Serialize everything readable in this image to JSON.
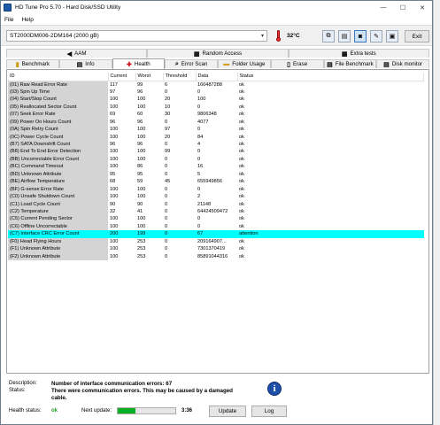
{
  "window": {
    "title": "HD Tune Pro 5.70 - Hard Disk/SSD Utility",
    "minimize": "—",
    "maximize": "☐",
    "close": "✕"
  },
  "menu": {
    "file": "File",
    "help": "Help"
  },
  "toolbar": {
    "drive": "ST2000DM006-2DM164 (2000 gB)",
    "temperature": "32°C",
    "exit": "Exit"
  },
  "tabs": {
    "top": [
      {
        "label": "AAM"
      },
      {
        "label": "Random Access"
      },
      {
        "label": "Extra tests"
      }
    ],
    "bottom": [
      {
        "label": "Benchmark"
      },
      {
        "label": "Info"
      },
      {
        "label": "Health"
      },
      {
        "label": "Error Scan"
      },
      {
        "label": "Folder Usage"
      },
      {
        "label": "Erase"
      },
      {
        "label": "File Benchmark"
      },
      {
        "label": "Disk monitor"
      }
    ],
    "active": "Health"
  },
  "table": {
    "columns": [
      "ID",
      "Current",
      "Worst",
      "Threshold",
      "Data",
      "Status"
    ],
    "rows": [
      [
        "(01) Raw Read Error Rate",
        "117",
        "99",
        "6",
        "160487288",
        "ok"
      ],
      [
        "(03) Spin Up Time",
        "97",
        "96",
        "0",
        "0",
        "ok"
      ],
      [
        "(04) Start/Stop Count",
        "100",
        "100",
        "20",
        "100",
        "ok"
      ],
      [
        "(05) Reallocated Sector Count",
        "100",
        "100",
        "10",
        "0",
        "ok"
      ],
      [
        "(07) Seek Error Rate",
        "69",
        "60",
        "30",
        "9806348",
        "ok"
      ],
      [
        "(09) Power On Hours Count",
        "96",
        "96",
        "0",
        "4077",
        "ok"
      ],
      [
        "(0A) Spin Retry Count",
        "100",
        "100",
        "97",
        "0",
        "ok"
      ],
      [
        "(0C) Power Cycle Count",
        "100",
        "100",
        "20",
        "84",
        "ok"
      ],
      [
        "(B7) SATA Downshift Count",
        "96",
        "96",
        "0",
        "4",
        "ok"
      ],
      [
        "(B8) End To End Error Detection",
        "100",
        "100",
        "99",
        "0",
        "ok"
      ],
      [
        "(BB) Uncorrectable Error Count",
        "100",
        "100",
        "0",
        "0",
        "ok"
      ],
      [
        "(BC) Command Timeout",
        "100",
        "86",
        "0",
        "16",
        "ok"
      ],
      [
        "(BD) Unknown Attribute",
        "95",
        "95",
        "0",
        "5",
        "ok"
      ],
      [
        "(BE) Airflow Temperature",
        "68",
        "59",
        "45",
        "655949856",
        "ok"
      ],
      [
        "(BF) G-sense Error Rate",
        "100",
        "100",
        "0",
        "0",
        "ok"
      ],
      [
        "(C0) Unsafe Shutdown Count",
        "100",
        "100",
        "0",
        "2",
        "ok"
      ],
      [
        "(C1) Load Cycle Count",
        "90",
        "90",
        "0",
        "21148",
        "ok"
      ],
      [
        "(C2) Temperature",
        "32",
        "41",
        "0",
        "64424509472",
        "ok"
      ],
      [
        "(C5) Current Pending Sector",
        "100",
        "100",
        "0",
        "0",
        "ok"
      ],
      [
        "(C6) Offline Uncorrectable",
        "100",
        "100",
        "0",
        "0",
        "ok"
      ],
      [
        "(C7) Interface CRC Error Count",
        "200",
        "199",
        "0",
        "67",
        "attention"
      ],
      [
        "(F0) Head Flying Hours",
        "100",
        "253",
        "0",
        "209164907...",
        "ok"
      ],
      [
        "(F1) Unknown Attribute",
        "100",
        "253",
        "0",
        "7301370419",
        "ok"
      ],
      [
        "(F2) Unknown Attribute",
        "100",
        "253",
        "0",
        "85891044316",
        "ok"
      ]
    ],
    "highlight_color": "#00ffff"
  },
  "bottom": {
    "description_label": "Description:",
    "description": "Number of interface communication errors: 67",
    "status_label": "Status:",
    "status_line1": "There were communication errors. This may be caused by a damaged",
    "status_line2": "cable.",
    "health_label": "Health status:",
    "health_value": "ok",
    "next_update_label": "Next update:",
    "next_update_time": "3:36",
    "progress_percent": 30,
    "update_button": "Update",
    "log_button": "Log"
  },
  "icons": [
    "app-icon",
    "thermometer-icon",
    "copy-icon",
    "copy-all-icon",
    "screenshot-icon",
    "options-icon",
    "save-icon",
    "info-icon"
  ]
}
